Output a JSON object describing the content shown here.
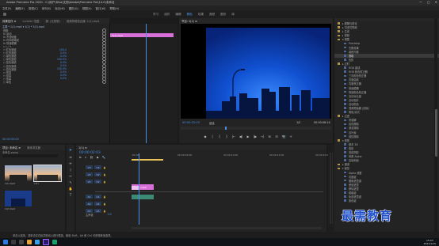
{
  "window": {
    "title": "Adobe Premiere Pro 2020 - C:\\用户\\Rika\\文档\\Adobe\\Premiere Pro\\14.0\\未命名",
    "controls": [
      "—",
      "▢",
      "✕"
    ]
  },
  "menu": [
    "文件(F)",
    "编辑(E)",
    "剪辑(C)",
    "序列(S)",
    "标记(M)",
    "图形(G)",
    "视图(V)",
    "窗口(W)",
    "帮助(H)"
  ],
  "workspaces": [
    {
      "label": "学习",
      "active": false
    },
    {
      "label": "组件",
      "active": false
    },
    {
      "label": "编辑",
      "active": false
    },
    {
      "label": "颜色",
      "active": true
    },
    {
      "label": "效果",
      "active": false
    },
    {
      "label": "音频",
      "active": false
    },
    {
      "label": "图形",
      "active": false
    },
    {
      "label": "库",
      "active": false
    }
  ],
  "effect_controls": {
    "tabs": [
      "效果控件 ≡",
      "Lumetri 范围",
      "源: (无剪辑)",
      "音频剪辑混合器: 1(1).mp4"
    ],
    "source_clip": "主要 * 1(1).mp4 ▾   1(1) * 1(1).mp4",
    "clip_chip": "1(1).mp4",
    "rows": [
      {
        "label": "视频",
        "value": ""
      },
      {
        "label": "fx 运动",
        "value": ""
      },
      {
        "label": "fx 不透明度",
        "value": ""
      },
      {
        "label": "fx 时间重映射",
        "value": ""
      },
      {
        "label": "fx 快速模糊",
        "value": ""
      },
      {
        "label": "○ □ ✎",
        "value": ""
      },
      {
        "label": "○ 红色通道",
        "value": "100.0"
      },
      {
        "label": "○ 红色通道",
        "value": "0.0%"
      },
      {
        "label": "○ 绿色通道",
        "value": "0.0%"
      },
      {
        "label": "○ 绿色通道",
        "value": "100.0%"
      },
      {
        "label": "○ 蓝色通道",
        "value": "0.0%"
      },
      {
        "label": "○ 蓝色通道",
        "value": "0.0%"
      },
      {
        "label": "○ 蓝色通道",
        "value": "100.0%"
      },
      {
        "label": "○ 常量",
        "value": "0.0%"
      },
      {
        "label": "○ 常量",
        "value": "0.0%"
      },
      {
        "label": "○ 常量",
        "value": "0.0%"
      },
      {
        "label": "○ 单色",
        "value": ""
      }
    ],
    "timecode": "00:00:00:00"
  },
  "program": {
    "tab": "节目: 1(1) ≡",
    "timecode_left": "00:00:02:03",
    "fit": "适合",
    "ratio": "1/2",
    "timecode_right": "00:00:08:14",
    "controls": [
      "◆",
      "|",
      "{",
      "}",
      "|←",
      "◀|",
      "▶",
      "|▶",
      "→|",
      "⊞",
      "⊟",
      "📷",
      "+"
    ]
  },
  "project": {
    "tabs": [
      "项目: 未命名 ≡",
      "媒体浏览器"
    ],
    "path": "未命名.prproj",
    "items": [
      {
        "name": "1(1).mp4",
        "duration": "8:14"
      },
      {
        "name": "1(1)",
        "duration": "8:14"
      },
      {
        "name": "1(2).mp4",
        "duration": "5:00"
      }
    ]
  },
  "timeline": {
    "tab": "1(1) ≡",
    "timecode": "00:00:02:03",
    "ruler": [
      ":00:00",
      "00:00:05:00",
      "00:00:10:00",
      "00:00:15:00",
      "00:00:20:00"
    ],
    "video_tracks": [
      "V3",
      "V2",
      "V1"
    ],
    "audio_tracks": [
      "A1",
      "A2",
      "A3"
    ],
    "master": "主声道",
    "master_value": "0.0",
    "clip_label": "fx 1(1).mp4",
    "audio_clip": "1(1).mp4"
  },
  "effects_panel": {
    "rows": [
      {
        "text": "▸ 模糊与锐化",
        "level": 1,
        "folder": true
      },
      {
        "text": "▸ 沉浸式视频",
        "level": 1,
        "folder": true
      },
      {
        "text": "▸ 生成",
        "level": 1,
        "folder": true
      },
      {
        "text": "▸ 视频",
        "level": 1,
        "folder": true
      },
      {
        "text": "▾ 调整",
        "level": 1,
        "folder": true
      },
      {
        "text": "ProcAmp",
        "level": 2,
        "folder": false
      },
      {
        "text": "光照效果",
        "level": 2,
        "folder": false
      },
      {
        "text": "卷积内核",
        "level": 2,
        "folder": false
      },
      {
        "text": "提取",
        "level": 2,
        "folder": false
      },
      {
        "text": "色阶",
        "level": 2,
        "folder": false
      },
      {
        "text": "▸ 过时",
        "level": 1,
        "folder": true
      },
      {
        "text": "RGB 曲线",
        "level": 2,
        "folder": false
      },
      {
        "text": "RGB 颜色校正器",
        "level": 2,
        "folder": false
      },
      {
        "text": "三向颜色校正器",
        "level": 2,
        "folder": false
      },
      {
        "text": "亮度曲线",
        "level": 2,
        "folder": false
      },
      {
        "text": "亮度校正器",
        "level": 2,
        "folder": false
      },
      {
        "text": "快速模糊",
        "level": 2,
        "folder": false
      },
      {
        "text": "快速颜色校正器",
        "level": 2,
        "folder": false
      },
      {
        "text": "自动对比度",
        "level": 2,
        "folder": false
      },
      {
        "text": "自动色阶",
        "level": 2,
        "folder": false
      },
      {
        "text": "自动颜色",
        "level": 2,
        "folder": false
      },
      {
        "text": "视频限幅器 (旧版)",
        "level": 2,
        "folder": false
      },
      {
        "text": "阴影/高光",
        "level": 2,
        "folder": false
      },
      {
        "text": "▸ 过渡",
        "level": 1,
        "folder": true
      },
      {
        "text": "块溶解",
        "level": 2,
        "folder": false
      },
      {
        "text": "径向擦除",
        "level": 2,
        "folder": false
      },
      {
        "text": "渐变擦除",
        "level": 2,
        "folder": false
      },
      {
        "text": "百叶窗",
        "level": 2,
        "folder": false
      },
      {
        "text": "线性擦除",
        "level": 2,
        "folder": false
      },
      {
        "text": "▾ 透视",
        "level": 1,
        "folder": true
      },
      {
        "text": "基本 3D",
        "level": 2,
        "folder": false
      },
      {
        "text": "投影",
        "level": 2,
        "folder": false
      },
      {
        "text": "放射阴影",
        "level": 2,
        "folder": false
      },
      {
        "text": "斜角 Alpha",
        "level": 2,
        "folder": false
      },
      {
        "text": "边缘斜面",
        "level": 2,
        "folder": false
      },
      {
        "text": "▸ 通道",
        "level": 1,
        "folder": true
      },
      {
        "text": "▾ 键控",
        "level": 1,
        "folder": true
      },
      {
        "text": "Alpha 调整",
        "level": 2,
        "folder": false
      },
      {
        "text": "亮度键",
        "level": 2,
        "folder": false
      },
      {
        "text": "图像遮罩键",
        "level": 2,
        "folder": false
      },
      {
        "text": "差值遮罩",
        "level": 2,
        "folder": false
      },
      {
        "text": "移除遮罩",
        "level": 2,
        "folder": false
      },
      {
        "text": "超级键",
        "level": 2,
        "folder": false
      },
      {
        "text": "轨道遮罩键",
        "level": 2,
        "folder": false
      },
      {
        "text": "颜色键",
        "level": 2,
        "folder": false
      }
    ]
  },
  "status_bar": "单击以选择，或单击空白处并拖动以进行框选。使用 Shift、Alt 和 Ctrl 可获得其他选项。",
  "watermark": "最需教育",
  "taskbar": {
    "time": "15:03",
    "date": "2021/1/15"
  }
}
